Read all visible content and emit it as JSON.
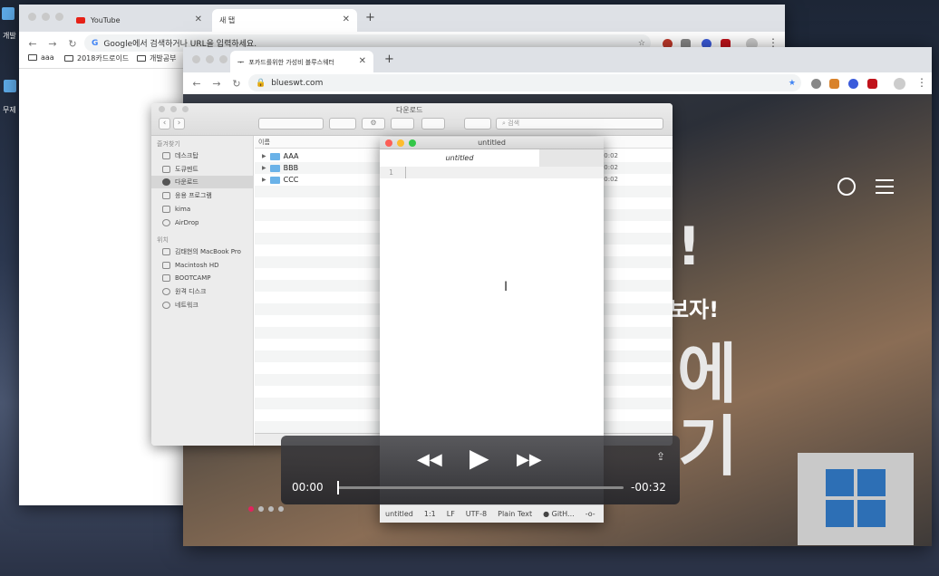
{
  "desktop": {
    "labels": [
      "개발",
      "무제 ("
    ]
  },
  "back_window": {
    "tabs": [
      {
        "title": "YouTube"
      },
      {
        "title": "새 탭"
      }
    ],
    "new_tab": "+",
    "omnibox_placeholder": "Google에서 검색하거나 URL을 입력하세요.",
    "bookmarks": [
      "aaa",
      "2018카드로이드",
      "개발공부"
    ]
  },
  "front_window": {
    "tab_title": "포카드를위한 가성비 블루스웨터",
    "url": "blueswt.com",
    "hero_lines": [
      "!",
      "보자!",
      "에",
      "기"
    ]
  },
  "finder": {
    "title": "다운로드",
    "search_placeholder": "검색",
    "sidebar_favorites_label": "즐겨찾기",
    "favorites": [
      "데스크탑",
      "도큐멘트",
      "다운로드",
      "응용 프로그램",
      "kima",
      "AirDrop"
    ],
    "locations_label": "위치",
    "locations": [
      "김태현의 MacBook Pro",
      "Macintosh HD",
      "BOOTCAMP",
      "원격 디스크",
      "네트워크"
    ],
    "column_name": "이름",
    "files": [
      {
        "name": "AAA",
        "time": "0:02"
      },
      {
        "name": "BBB",
        "time": "0:02"
      },
      {
        "name": "CCC",
        "time": "0:02"
      }
    ]
  },
  "editor": {
    "title": "untitled",
    "tab_label": "untitled",
    "line_number": "1",
    "status": {
      "file": "untitled",
      "position": "1:1",
      "eol": "LF",
      "encoding": "UTF-8",
      "grammar": "Plain Text",
      "github": "GitH..."
    }
  },
  "video": {
    "current_time": "00:00",
    "remaining_time": "-00:32",
    "progress": 0.0
  },
  "colors": {
    "chrome_tab_bg": "#dee1e6",
    "finder_sidebar": "#ececec",
    "accent_blue": "#1a73e8",
    "windows_logo": "#2d6fb5"
  }
}
